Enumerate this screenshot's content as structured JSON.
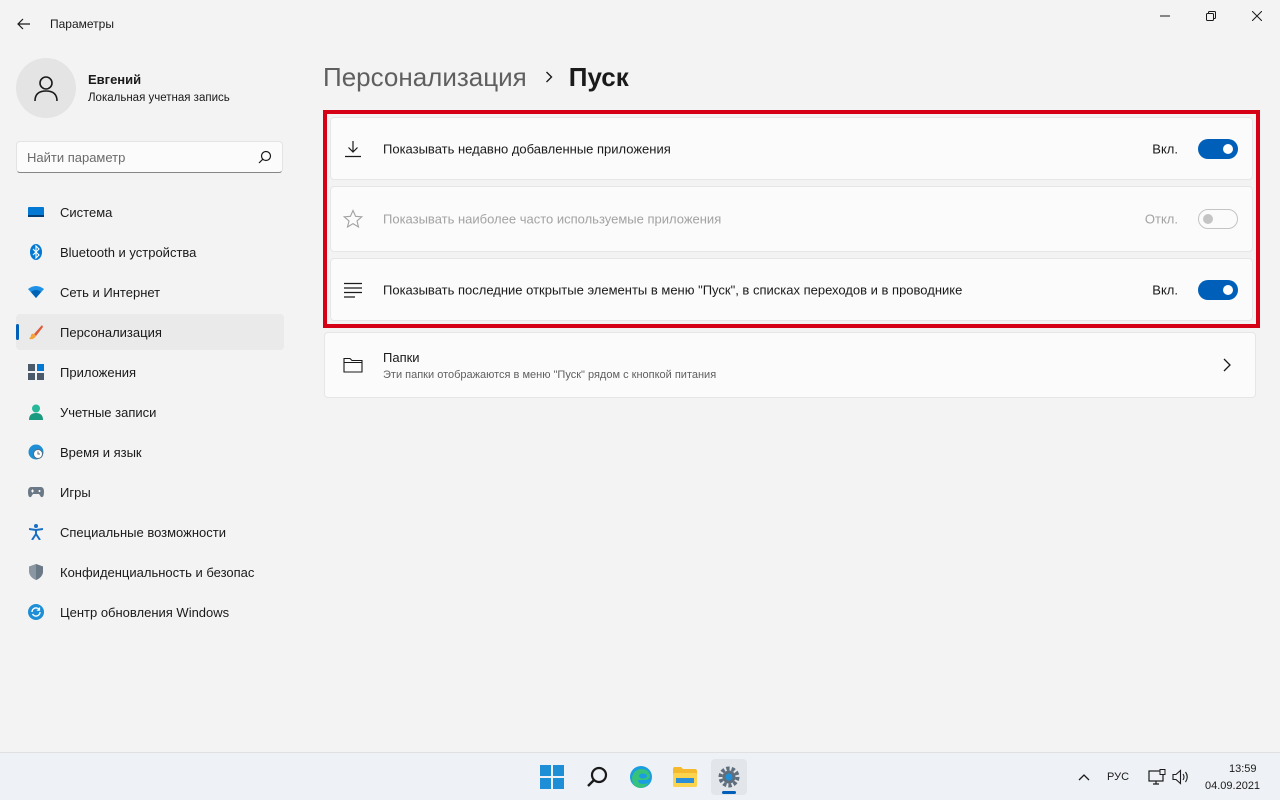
{
  "window": {
    "title": "Параметры"
  },
  "profile": {
    "name": "Евгений",
    "account_type": "Локальная учетная запись"
  },
  "search": {
    "placeholder": "Найти параметр"
  },
  "sidebar": {
    "items": [
      {
        "label": "Система",
        "icon": "system-icon",
        "active": false
      },
      {
        "label": "Bluetooth и устройства",
        "icon": "bluetooth-icon",
        "active": false
      },
      {
        "label": "Сеть и Интернет",
        "icon": "wifi-icon",
        "active": false
      },
      {
        "label": "Персонализация",
        "icon": "brush-icon",
        "active": true
      },
      {
        "label": "Приложения",
        "icon": "apps-icon",
        "active": false
      },
      {
        "label": "Учетные записи",
        "icon": "person-icon",
        "active": false
      },
      {
        "label": "Время и язык",
        "icon": "globe-clock-icon",
        "active": false
      },
      {
        "label": "Игры",
        "icon": "gamepad-icon",
        "active": false
      },
      {
        "label": "Специальные возможности",
        "icon": "accessibility-icon",
        "active": false
      },
      {
        "label": "Конфиденциальность и безопас",
        "icon": "shield-icon",
        "active": false
      },
      {
        "label": "Центр обновления Windows",
        "icon": "update-icon",
        "active": false
      }
    ]
  },
  "header": {
    "parent": "Персонализация",
    "current": "Пуск"
  },
  "settings": [
    {
      "label": "Показывать недавно добавленные приложения",
      "state": "Вкл.",
      "on": true,
      "disabled": false,
      "icon": "download-icon"
    },
    {
      "label": "Показывать наиболее часто используемые приложения",
      "state": "Откл.",
      "on": false,
      "disabled": true,
      "icon": "star-icon"
    },
    {
      "label": "Показывать последние открытые элементы в меню \"Пуск\", в списках переходов и в проводнике",
      "state": "Вкл.",
      "on": true,
      "disabled": false,
      "icon": "list-icon"
    }
  ],
  "folders": {
    "title": "Папки",
    "subtitle": "Эти папки отображаются в меню \"Пуск\" рядом с кнопкой питания"
  },
  "highlight_color": "#d50016",
  "accent_color": "#005fb8",
  "taskbar": {
    "apps": [
      "start-icon",
      "search-icon",
      "edge-icon",
      "explorer-icon",
      "settings-icon"
    ],
    "language": "РУС",
    "time": "13:59",
    "date": "04.09.2021"
  }
}
